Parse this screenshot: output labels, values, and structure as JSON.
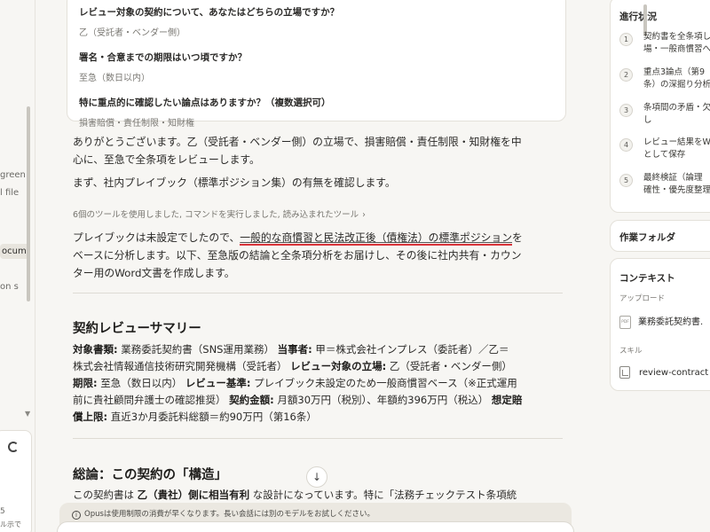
{
  "left_sidebar": {
    "fragments": [
      "green",
      "l file",
      "ocum",
      "on s"
    ],
    "bottom_text": [
      "5",
      "ル示で"
    ]
  },
  "questions": [
    {
      "q": "レビュー対象の契約について、あなたはどちらの立場ですか？",
      "a": "乙（受託者・ベンダー側）"
    },
    {
      "q": "署名・合意までの期限はいつ頃ですか？",
      "a": "至急（数日以内）"
    },
    {
      "q": "特に重点的に確認したい論点はありますか？（複数選択可）",
      "a": "損害賠償・責任制限・知財権"
    }
  ],
  "assistant": {
    "ack_line1": "ありがとうございます。乙（受託者・ベンダー側）の立場で、損害賠償・責任制限・知財権を中",
    "ack_line2": "心に、至急で全条項をレビューします。",
    "check": "まず、社内プレイブック（標準ポジション集）の有無を確認します。",
    "tools_summary": "6個のツールを使用しました, コマンドを実行しました, 読み込まれたツール",
    "body_pre": "プレイブックは未設定でしたので、",
    "body_highlight": "一般的な商慣習と民法改正後（債権法）の標準ポジション",
    "body_post1": "を",
    "body_line2": "ベースに分析します。以下、至急版の結論と全条項分析をお届けし、その後に社内共有・カウン",
    "body_line3": "ター用のWord文書を作成します。"
  },
  "summary": {
    "heading": "契約レビューサマリー",
    "line1_label1": "対象書類:",
    "line1_val1": " 業務委託契約書（SNS運用業務） ",
    "line1_label2": "当事者:",
    "line1_val2": " 甲＝株式会社インプレス（委託者）／乙＝",
    "line2_val": "株式会社情報通信技術研究開発機構（受託者） ",
    "line2_label": "レビュー対象の立場:",
    "line2_val2": " 乙（受託者・ベンダー側）",
    "line3_label1": "期限:",
    "line3_val1": " 至急（数日以内） ",
    "line3_label2": "レビュー基準:",
    "line3_val2": " プレイブック未設定のため一般商慣習ベース（※正式運用",
    "line4_val": "前に貴社顧問弁護士の確認推奨） ",
    "line4_label1": "契約金額:",
    "line4_val2": " 月額30万円（税別）、年額約396万円（税込） ",
    "line4_label2": "想定賠",
    "line5_label": "償上限:",
    "line5_val": " 直近3か月委託料総額＝約90万円（第16条）"
  },
  "overview": {
    "heading": "総論：この契約の「構造」",
    "text_pre": "この契約書は ",
    "text_bold": "乙（貴社）側に相当有利",
    "text_post": " な設計になっています。特に「法務チェックテスト条項統"
  },
  "notice": "Opusは使用制限の消費が早くなります。長い会話には別のモデルをお試しください。",
  "right_panel": {
    "progress_title": "進行状況",
    "steps": [
      {
        "num": "1",
        "line1": "契約書を全条項し",
        "line2": "場・一般商慣習へ"
      },
      {
        "num": "2",
        "line1": "重点3論点（第9",
        "line2": "条）の深掘り分析"
      },
      {
        "num": "3",
        "line1": "条項間の矛盾・欠",
        "line2": "し"
      },
      {
        "num": "4",
        "line1": "レビュー結果をWor",
        "line2": "として保存"
      },
      {
        "num": "5",
        "line1": "最終検証（論理",
        "line2": "確性・優先度整理"
      }
    ],
    "folder_title": "作業フォルダ",
    "context_title": "コンテキスト",
    "upload_label": "アップロード",
    "upload_file": "業務委託契約書.",
    "file_icon_text": "PDF",
    "skill_label": "スキル",
    "skill_name": "review-contract"
  }
}
